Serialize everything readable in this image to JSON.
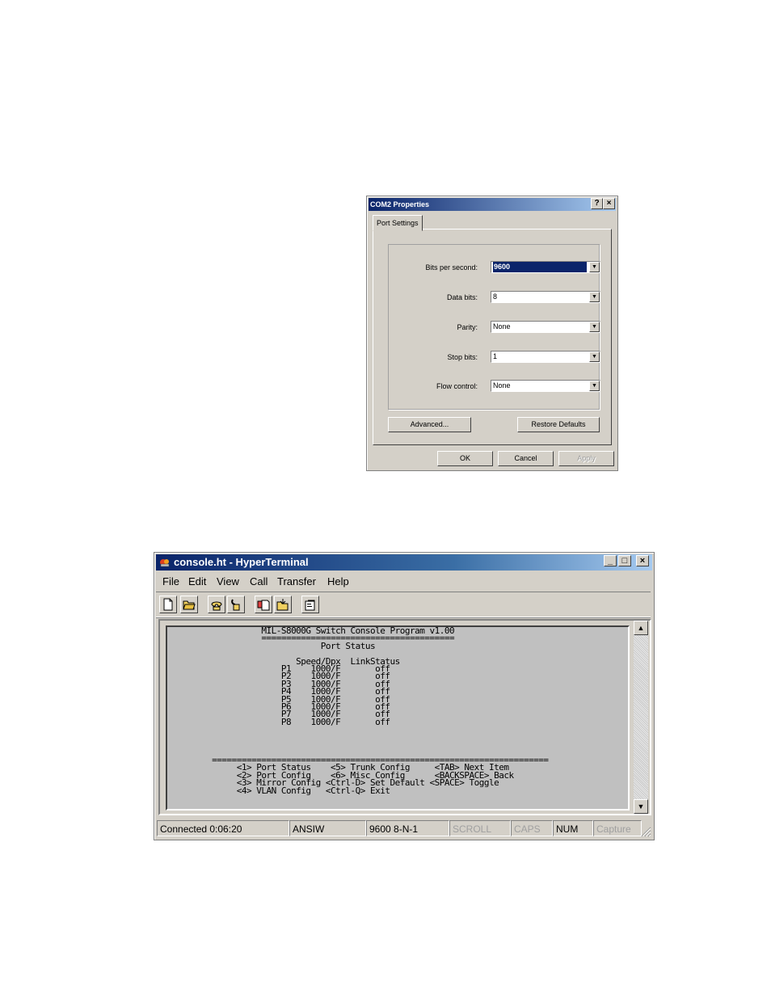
{
  "dialog": {
    "title": "COM2 Properties",
    "help_label": "?",
    "close_label": "×",
    "tab": "Port Settings",
    "fields": [
      {
        "label": "Bits per second:",
        "value": "9600"
      },
      {
        "label": "Data bits:",
        "value": "8"
      },
      {
        "label": "Parity:",
        "value": "None"
      },
      {
        "label": "Stop bits:",
        "value": "1"
      },
      {
        "label": "Flow control:",
        "value": "None"
      }
    ],
    "advanced_label": "Advanced...",
    "restore_label": "Restore Defaults",
    "ok_label": "OK",
    "cancel_label": "Cancel",
    "apply_label": "Apply"
  },
  "hyperterminal": {
    "title": "console.ht - HyperTerminal",
    "menu": [
      "File",
      "Edit",
      "View",
      "Call",
      "Transfer",
      "Help"
    ],
    "toolbar_icons": [
      "new-icon",
      "open-icon",
      "connect-icon",
      "disconnect-icon",
      "send-icon",
      "receive-icon",
      "properties-icon"
    ],
    "terminal_text": "                   MIL-S8000G Switch Console Program v1.00\n                   =======================================\n                               Port Status\n\n                          Speed/Dpx  LinkStatus\n                       P1    1000/F       off\n                       P2    1000/F       off\n                       P3    1000/F       off\n                       P4    1000/F       off\n                       P5    1000/F       off\n                       P6    1000/F       off\n                       P7    1000/F       off\n                       P8    1000/F       off\n\n\n\n\n         ====================================================================\n              <1> Port Status    <5> Trunk Config     <TAB> Next Item\n              <2> Port Config    <6> Misc Config      <BACKSPACE> Back\n              <3> Mirror Config <Ctrl-D> Set Default <SPACE> Toggle\n              <4> VLAN Config   <Ctrl-Q> Exit",
    "status": {
      "connected": "Connected 0:06:20",
      "emulation": "ANSIW",
      "settings": "9600 8-N-1",
      "scroll": "SCROLL",
      "caps": "CAPS",
      "num": "NUM",
      "capture": "Capture"
    }
  }
}
